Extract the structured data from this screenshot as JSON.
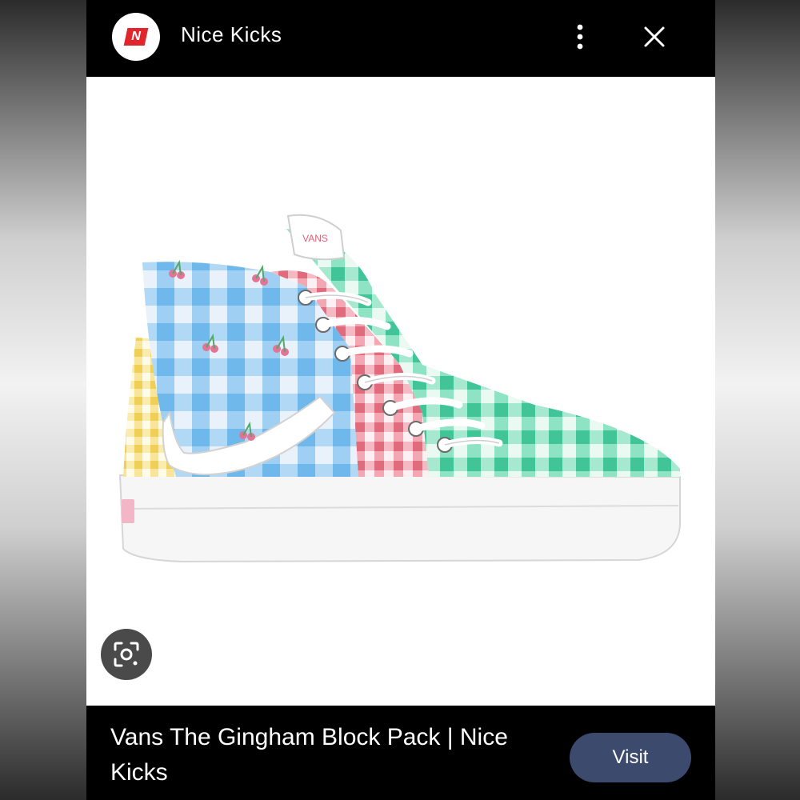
{
  "header": {
    "site_name": "Nice Kicks",
    "logo_letter": "N",
    "logo_color": "#e0262c"
  },
  "image": {
    "subject": "gingham high-top sneaker",
    "logo_text": "VANS"
  },
  "icons": {
    "menu": "more-vert-icon",
    "close": "close-icon",
    "lens": "lens-search-icon"
  },
  "result": {
    "title": "Vans The Gingham Block Pack | Nice Kicks",
    "visit_label": "Visit",
    "visit_color": "#3c4a6e"
  }
}
